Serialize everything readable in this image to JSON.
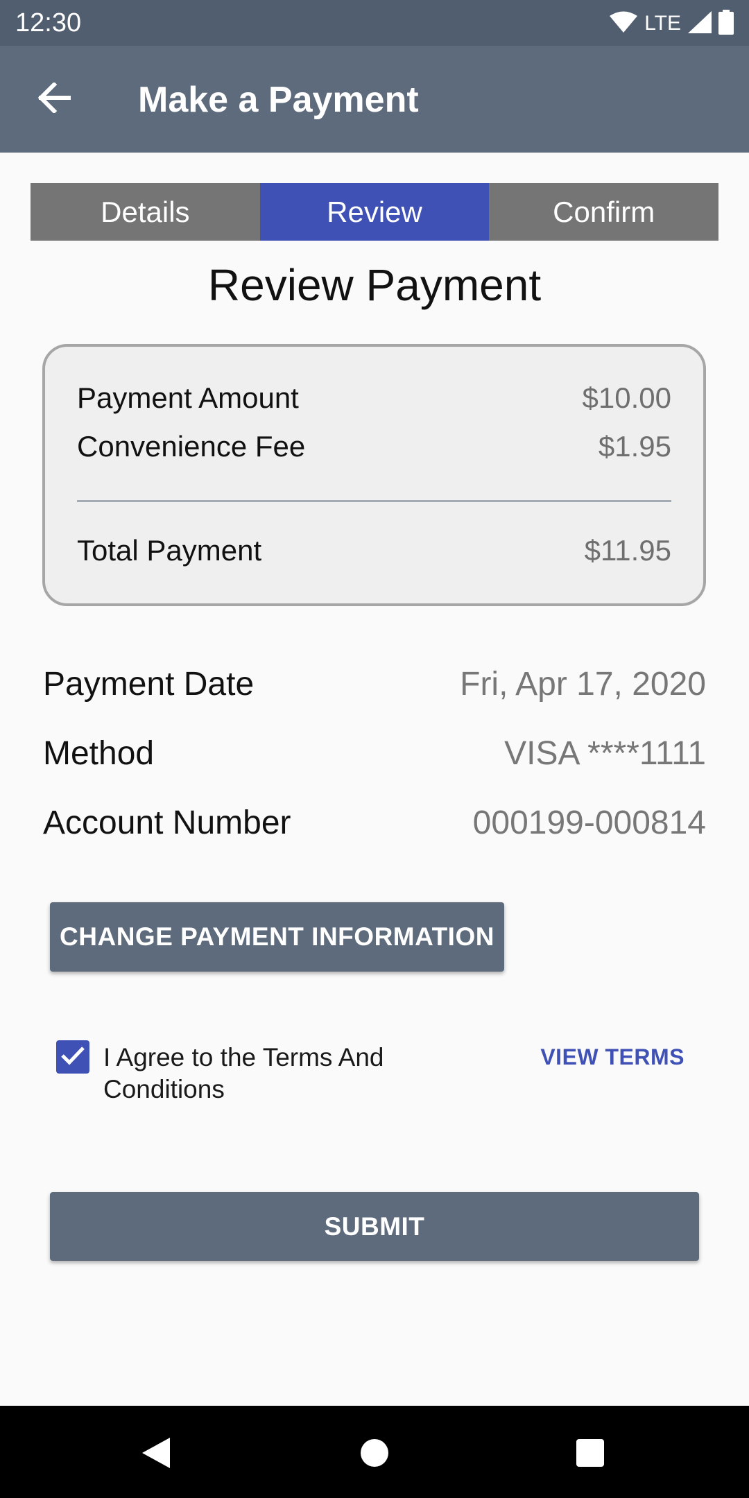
{
  "status_bar": {
    "time": "12:30",
    "network": "LTE"
  },
  "app_bar": {
    "title": "Make a Payment",
    "back_icon": "arrow-left-icon"
  },
  "tabs": [
    {
      "label": "Details",
      "active": false
    },
    {
      "label": "Review",
      "active": true
    },
    {
      "label": "Confirm",
      "active": false
    }
  ],
  "review": {
    "title": "Review Payment",
    "summary": {
      "payment_amount_label": "Payment Amount",
      "payment_amount_value": "$10.00",
      "fee_label": "Convenience Fee",
      "fee_value": "$1.95",
      "total_label": "Total Payment",
      "total_value": "$11.95"
    },
    "details": [
      {
        "label": "Payment Date",
        "value": "Fri, Apr 17, 2020"
      },
      {
        "label": "Method",
        "value": "VISA ****1111"
      },
      {
        "label": "Account Number",
        "value": "000199-000814"
      }
    ],
    "change_button": "CHANGE PAYMENT INFORMATION",
    "terms": {
      "checked": true,
      "agree_text": "I Agree to the Terms And Conditions",
      "view_terms_label": "VIEW TERMS"
    },
    "submit_button": "SUBMIT"
  },
  "colors": {
    "status_bar": "#505e6f",
    "app_bar": "#5e6b7c",
    "accent": "#3f51b5",
    "tab_inactive": "#757575"
  }
}
